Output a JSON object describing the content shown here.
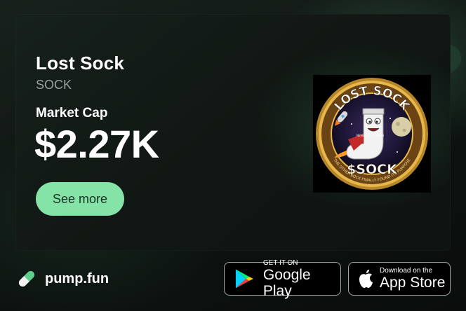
{
  "token": {
    "name": "Lost Sock",
    "ticker": "SOCK",
    "market_cap_label": "Market Cap",
    "market_cap_value": "$2.27K",
    "see_more_label": "See more",
    "logo": {
      "top_text": "LOST SOCK",
      "bottom_text": "$SOCK",
      "ring_text": "THE OTHER SOCK FINALLY FOUND ITS PURPOSE",
      "badge_text": "NEVER LOST AGAIN"
    }
  },
  "footer": {
    "brand_name": "pump.fun",
    "google_play": {
      "small": "GET IT ON",
      "big": "Google Play"
    },
    "app_store": {
      "small": "Download on the",
      "big": "App Store"
    }
  },
  "colors": {
    "accent_button": "#86e3a8",
    "background": "#0f1311",
    "muted_text": "#9aa19d"
  }
}
